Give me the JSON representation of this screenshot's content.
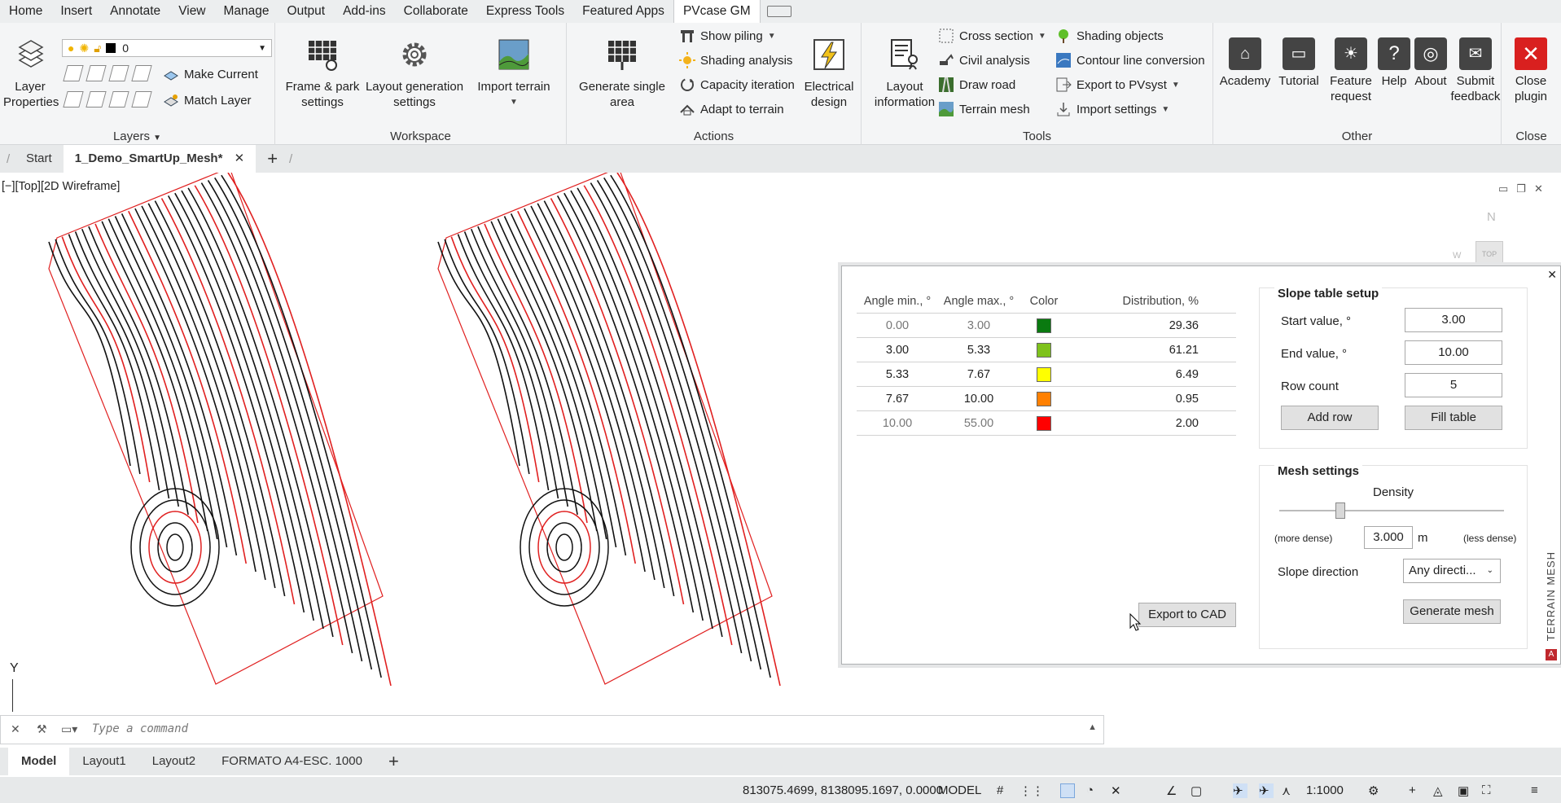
{
  "menu": {
    "items": [
      "Home",
      "Insert",
      "Annotate",
      "View",
      "Manage",
      "Output",
      "Add-ins",
      "Collaborate",
      "Express Tools",
      "Featured Apps",
      "PVcase GM"
    ],
    "active": "PVcase GM"
  },
  "ribbon": {
    "layers": {
      "title": "Layers",
      "layer_properties": "Layer Properties",
      "current_layer": "0",
      "make_current": "Make Current",
      "match_layer": "Match Layer"
    },
    "workspace": {
      "title": "Workspace",
      "frame_park": "Frame & park settings",
      "layout_generation": "Layout generation settings",
      "import_terrain": "Import terrain"
    },
    "actions": {
      "title": "Actions",
      "generate_single_area": "Generate single area",
      "show_piling": "Show piling",
      "shading_analysis": "Shading analysis",
      "capacity_iteration": "Capacity iteration",
      "adapt_to_terrain": "Adapt to terrain",
      "electrical_design": "Electrical design"
    },
    "tools": {
      "title": "Tools",
      "layout_information": "Layout information",
      "cross_section": "Cross section",
      "civil_analysis": "Civil analysis",
      "draw_road": "Draw road",
      "terrain_mesh": "Terrain mesh",
      "shading_objects": "Shading objects",
      "contour_line_conversion": "Contour line conversion",
      "export_to_pvsyst": "Export to PVsyst",
      "import_settings": "Import settings"
    },
    "other": {
      "title": "Other",
      "academy": "Academy",
      "tutorial": "Tutorial",
      "feature_request": "Feature request",
      "help": "Help",
      "about": "About",
      "submit_feedback": "Submit feedback"
    },
    "close": {
      "title": "Close",
      "close_plugin": "Close plugin"
    }
  },
  "doc_tabs": {
    "start": "Start",
    "active": "1_Demo_SmartUp_Mesh*"
  },
  "viewport": {
    "label": "[−][Top][2D Wireframe]",
    "compass_n": "N",
    "compass_top": "TOP",
    "compass_w": "W",
    "ucs_y": "Y"
  },
  "plugin": {
    "side_tab": "TERRAIN MESH",
    "table": {
      "headers": [
        "Angle min., °",
        "Angle max., °",
        "Color",
        "Distribution, %"
      ],
      "rows": [
        {
          "min": "0.00",
          "max": "3.00",
          "color": "#0a7a10",
          "dist": "29.36",
          "muted": true
        },
        {
          "min": "3.00",
          "max": "5.33",
          "color": "#7ec21c",
          "dist": "61.21",
          "muted": false
        },
        {
          "min": "5.33",
          "max": "7.67",
          "color": "#ffff00",
          "dist": "6.49",
          "muted": false
        },
        {
          "min": "7.67",
          "max": "10.00",
          "color": "#ff8000",
          "dist": "0.95",
          "muted": false
        },
        {
          "min": "10.00",
          "max": "55.00",
          "color": "#ff0000",
          "dist": "2.00",
          "muted": true
        }
      ]
    },
    "export_to_cad": "Export to CAD",
    "slope_setup": {
      "title": "Slope table setup",
      "start_label": "Start value, °",
      "start_value": "3.00",
      "end_label": "End value, °",
      "end_value": "10.00",
      "row_count_label": "Row count",
      "row_count_value": "5",
      "add_row": "Add row",
      "fill_table": "Fill table"
    },
    "mesh_settings": {
      "title": "Mesh settings",
      "density_label": "Density",
      "density_value": "3.000",
      "density_unit": "m",
      "more_dense": "(more dense)",
      "less_dense": "(less dense)",
      "density_position": 0.27,
      "slope_direction_label": "Slope direction",
      "slope_direction_value": "Any directi...",
      "generate_mesh": "Generate mesh"
    }
  },
  "command": {
    "placeholder": "Type a command"
  },
  "layout_tabs": [
    "Model",
    "Layout1",
    "Layout2",
    "FORMATO A4-ESC. 1000"
  ],
  "status": {
    "coords": "813075.4699, 8138095.1697, 0.0000",
    "model": "MODEL",
    "scale": "1:1000"
  },
  "colors": {
    "contour_black": "#111111",
    "contour_red": "#e02020",
    "accent_blue": "#2a62c9",
    "close_red": "#d9201f"
  }
}
